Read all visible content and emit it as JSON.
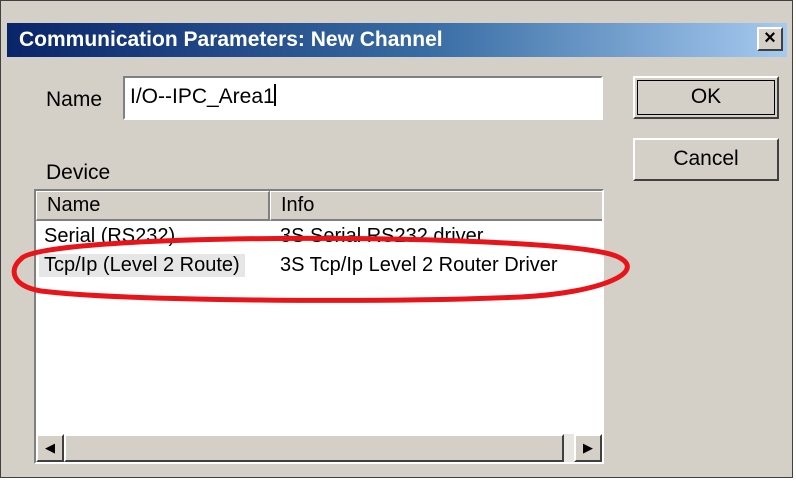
{
  "window": {
    "title": "Communication Parameters: New Channel",
    "close_label": "×"
  },
  "name_field": {
    "label": "Name",
    "value": "I/O--IPC_Area1"
  },
  "buttons": {
    "ok": "OK",
    "cancel": "Cancel"
  },
  "device": {
    "label": "Device",
    "columns": [
      "Name",
      "Info"
    ],
    "rows": [
      {
        "name": "Serial (RS232)",
        "info": "3S Serial RS232 driver"
      },
      {
        "name": "Tcp/Ip (Level 2 Route)",
        "info": "3S Tcp/Ip Level 2 Router Driver",
        "selected": true
      }
    ]
  },
  "scrollbar": {
    "left_arrow": "◀",
    "right_arrow": "▶"
  },
  "annotation": {
    "color": "#e8141a",
    "shape": "red-ellipse-highlight"
  }
}
